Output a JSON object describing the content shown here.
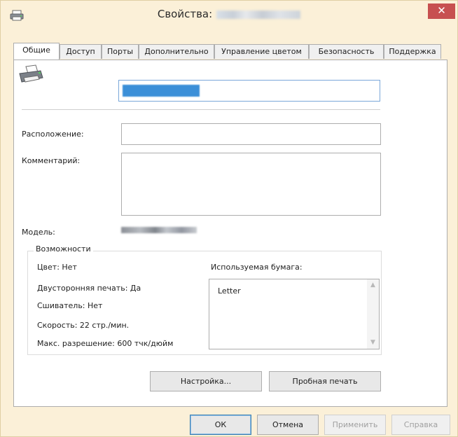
{
  "window": {
    "title": "Свойства:",
    "close_glyph": "✕"
  },
  "tabs": [
    {
      "label": "Общие",
      "active": true
    },
    {
      "label": "Доступ"
    },
    {
      "label": "Порты"
    },
    {
      "label": "Дополнительно"
    },
    {
      "label": "Управление цветом"
    },
    {
      "label": "Безопасность"
    },
    {
      "label": "Поддержка"
    }
  ],
  "general": {
    "location_label": "Расположение:",
    "location_value": "",
    "comment_label": "Комментарий:",
    "comment_value": "",
    "model_label": "Модель:"
  },
  "features": {
    "title": "Возможности",
    "color": "Цвет: Нет",
    "duplex": "Двусторонняя печать: Да",
    "stapler": "Сшиватель: Нет",
    "speed": "Скорость: 22 стр./мин.",
    "max_resolution": "Макс. разрешение: 600 тчк/дюйм",
    "paper_label": "Используемая бумага:",
    "paper_items": [
      "Letter"
    ]
  },
  "panel_buttons": {
    "setup": "Настройка...",
    "test_print": "Пробная печать"
  },
  "dialog_buttons": {
    "ok": "ОК",
    "cancel": "Отмена",
    "apply": "Применить",
    "help": "Справка"
  },
  "icons": {
    "window": "printer-icon",
    "header": "printer-icon",
    "scroll_up": "▲",
    "scroll_down": "▼"
  },
  "colors": {
    "window_frame": "#fbf0d8",
    "close_button": "#c75050",
    "selection": "#3b8fd8",
    "focus_border": "#7aa7d9"
  }
}
